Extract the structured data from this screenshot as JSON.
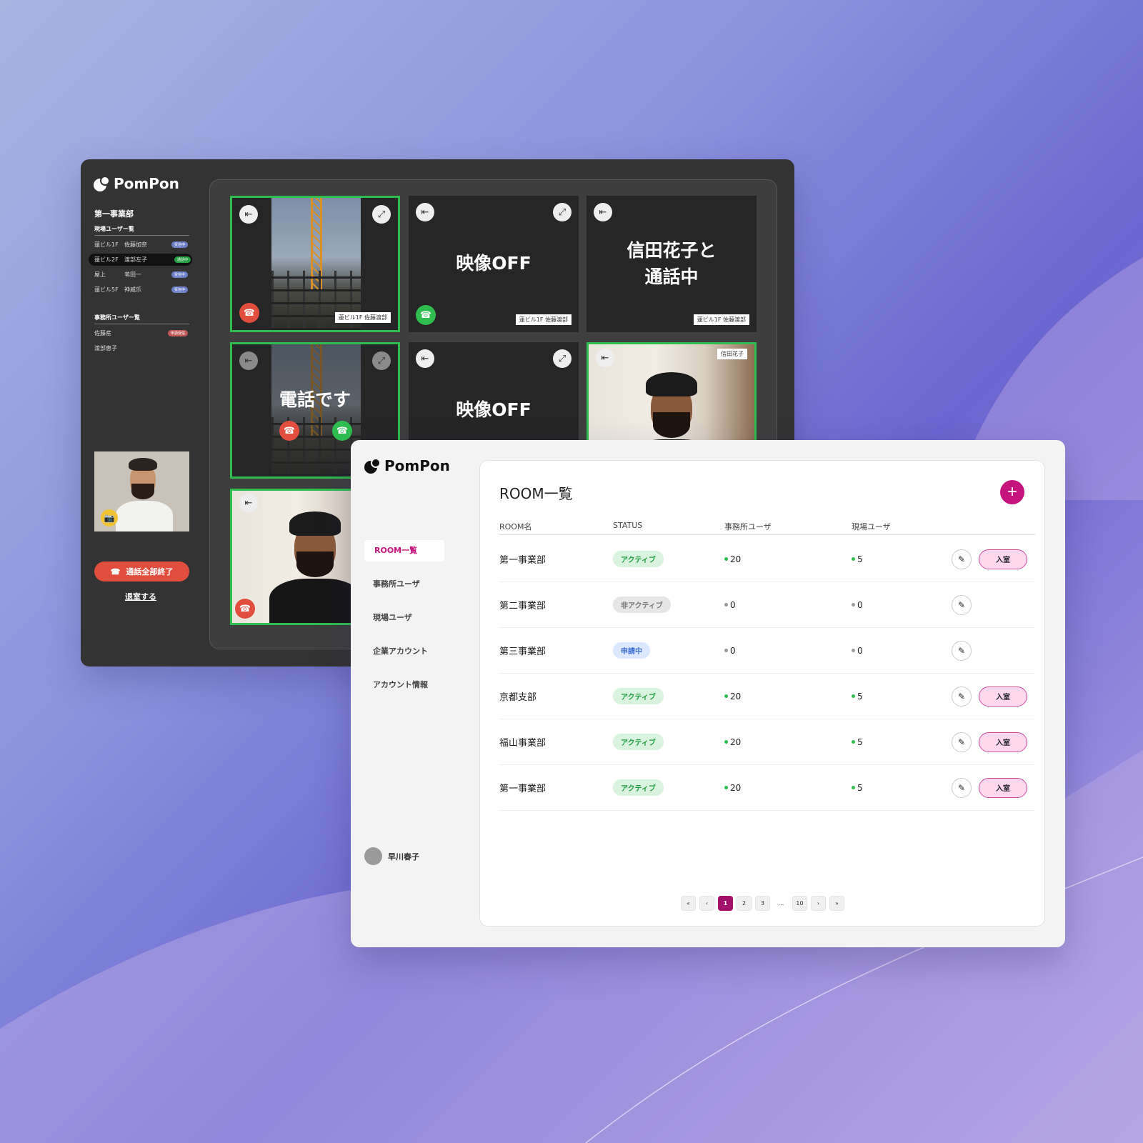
{
  "colors": {
    "accent": "#c5147c",
    "ring_green": "#2fbd4f",
    "call_red": "#e14e3e"
  },
  "dark_app": {
    "brand": "PomPon",
    "dept": "第一事業部",
    "site_section": "現場ユーザー覧",
    "site_users": [
      {
        "loc": "蓮ビル1F",
        "name": "佐藤加奈",
        "badge": "受信中"
      },
      {
        "loc": "蓮ビル2F",
        "name": "渡部左子",
        "badge": "通話中"
      },
      {
        "loc": "屋上",
        "name": "苇田一",
        "badge": "受信中"
      },
      {
        "loc": "蓮ビル5F",
        "name": "神威乐",
        "badge": "受信中"
      }
    ],
    "office_section": "事務所ユーザー覧",
    "office_users": [
      {
        "name": "佐藤産",
        "badge": "申請受信"
      },
      {
        "name": "渡部恵子",
        "badge": ""
      }
    ],
    "end_all_label": "通話全部終了",
    "leave_label": "退室する",
    "tiles": {
      "video_off": "映像OFF",
      "in_call_line1": "信田花子と",
      "in_call_line2": "通話中",
      "incoming": "電話です",
      "label_site": "蓮ビル1F 佐藤渡部",
      "label_person": "信田花子",
      "label_partial": "蓮ビ"
    },
    "icons": {
      "leave": "leave-icon",
      "expand": "expand-icon",
      "hangup": "hangup-icon",
      "answer": "phone-icon",
      "camera": "camera-icon"
    }
  },
  "admin_app": {
    "brand": "PomPon",
    "nav": [
      "ROOM一覧",
      "事務所ユーザ",
      "現場ユーザ",
      "企業アカウント",
      "アカウント情報"
    ],
    "user_name": "早川春子",
    "title": "ROOM一覧",
    "add_label": "+",
    "columns": [
      "ROOM名",
      "STATUS",
      "事務所ユーザ",
      "現場ユーザ"
    ],
    "enter_label": "入室",
    "rows": [
      {
        "name": "第一事業部",
        "status": "アクティブ",
        "office": "20",
        "site": "5"
      },
      {
        "name": "第二事業部",
        "status": "非アクティブ",
        "office": "0",
        "site": "0"
      },
      {
        "name": "第三事業部",
        "status": "申請中",
        "office": "0",
        "site": "0"
      },
      {
        "name": "京都支部",
        "status": "アクティブ",
        "office": "20",
        "site": "5"
      },
      {
        "name": "福山事業部",
        "status": "アクティブ",
        "office": "20",
        "site": "5"
      },
      {
        "name": "第一事業部",
        "status": "アクティブ",
        "office": "20",
        "site": "5"
      }
    ],
    "pagination": {
      "first": "«",
      "prev": "‹",
      "pages": [
        "1",
        "2",
        "3",
        "...",
        "10"
      ],
      "next": "›",
      "last": "»",
      "current": "1"
    }
  }
}
